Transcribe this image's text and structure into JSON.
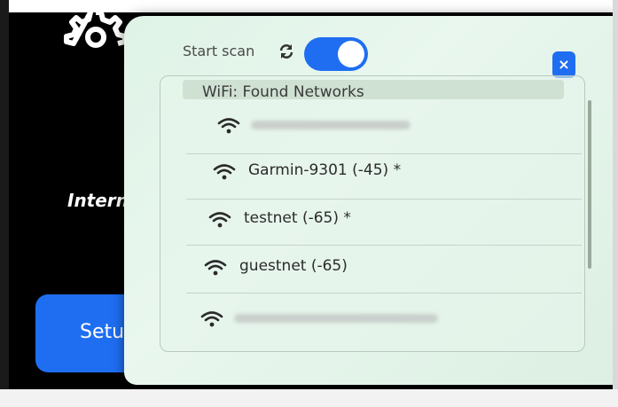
{
  "background": {
    "internet_label": "Interne",
    "setup_button": "Setu"
  },
  "modal": {
    "scan_label": "Start scan",
    "toggle_on": true,
    "close_symbol": "×",
    "list_title": "WiFi: Found Networks",
    "networks": [
      {
        "name": "",
        "redacted": true
      },
      {
        "name": "Garmin-9301 (-45) *",
        "redacted": false
      },
      {
        "name": "testnet (-65) *",
        "redacted": false
      },
      {
        "name": "guestnet (-65)",
        "redacted": false
      },
      {
        "name": "",
        "redacted": true
      }
    ]
  },
  "colors": {
    "accent": "#1f6ef2",
    "modal_bg": "#e6f5ec"
  }
}
